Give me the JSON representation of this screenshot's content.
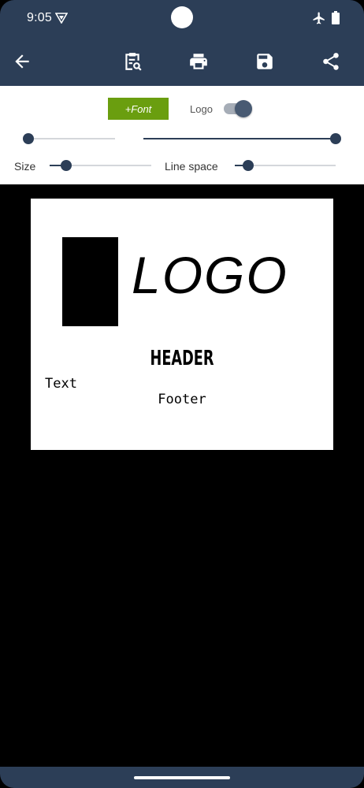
{
  "status_bar": {
    "time": "9:05"
  },
  "toolbar": {
    "back_icon": "arrow-back-icon",
    "preview_icon": "clipboard-search-icon",
    "print_icon": "print-icon",
    "save_icon": "save-icon",
    "share_icon": "share-icon"
  },
  "controls": {
    "font_button": "+Font",
    "logo_toggle_label": "Logo",
    "logo_toggle_on": true,
    "slider_left_value": 0.0,
    "slider_right_value": 1.0,
    "size_label": "Size",
    "size_value": 0.16,
    "line_space_label": "Line space",
    "line_space_value": 0.13
  },
  "label_preview": {
    "logo_text": "LOGO",
    "header": "HEADER",
    "text": "Text",
    "footer": "Footer"
  },
  "colors": {
    "appbar": "#2c3e57",
    "accent": "#6a9e0f",
    "background": "#000000"
  }
}
